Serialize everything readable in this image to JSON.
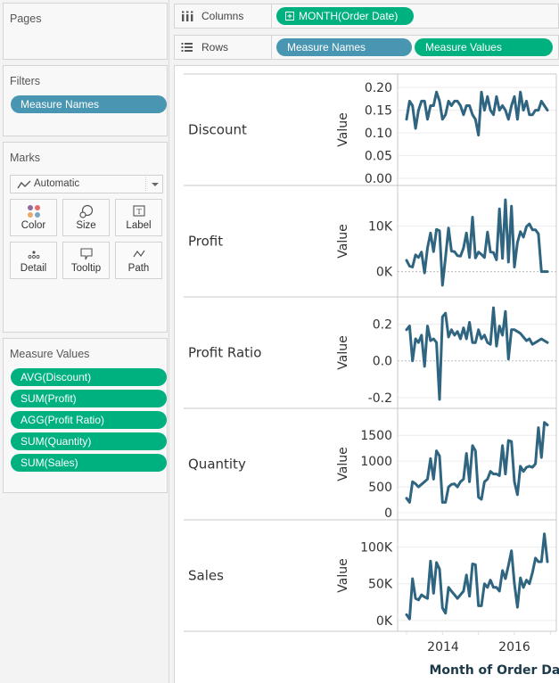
{
  "left_panel": {
    "pages": {
      "title": "Pages"
    },
    "filters": {
      "title": "Filters",
      "pills": [
        {
          "label": "Measure Names",
          "color": "#4996b2"
        }
      ]
    },
    "marks": {
      "title": "Marks",
      "mark_type": "Automatic",
      "buttons": [
        {
          "label": "Color",
          "icon": "color-dots-icon"
        },
        {
          "label": "Size",
          "icon": "size-icon"
        },
        {
          "label": "Label",
          "icon": "label-icon"
        },
        {
          "label": "Detail",
          "icon": "detail-icon"
        },
        {
          "label": "Tooltip",
          "icon": "tooltip-icon"
        },
        {
          "label": "Path",
          "icon": "path-icon"
        }
      ]
    },
    "measure_values": {
      "title": "Measure Values",
      "pills": [
        {
          "label": "AVG(Discount)"
        },
        {
          "label": "SUM(Profit)"
        },
        {
          "label": "AGG(Profit Ratio)"
        },
        {
          "label": "SUM(Quantity)"
        },
        {
          "label": "SUM(Sales)"
        }
      ]
    }
  },
  "shelves": {
    "columns": {
      "label": "Columns",
      "pills": [
        {
          "label": "MONTH(Order Date)",
          "color": "#00b180",
          "has_expand": true
        }
      ]
    },
    "rows": {
      "label": "Rows",
      "pills": [
        {
          "label": "Measure Names",
          "color": "#4996b2"
        },
        {
          "label": "Measure Values",
          "color": "#00b180"
        }
      ]
    }
  },
  "colors": {
    "line": "#2f6580",
    "pill_blue": "#4996b2",
    "pill_green": "#00b180",
    "axis_text": "#333333"
  },
  "chart_data": {
    "type": "line",
    "xlabel": "Month of Order Date",
    "x_start": "2014-01",
    "x_end": "2017-12",
    "x_tick_labels": [
      "2014",
      "2016"
    ],
    "y_axis_title": "Value",
    "panels": [
      {
        "name": "Discount",
        "ylim": [
          0,
          0.21
        ],
        "ticks": [
          "0.20",
          "0.15",
          "0.10",
          "0.05",
          "0.00"
        ],
        "tick_values": [
          0.2,
          0.15,
          0.1,
          0.05,
          0.0
        ],
        "zero_line": false,
        "values": [
          0.13,
          0.17,
          0.16,
          0.11,
          0.15,
          0.17,
          0.17,
          0.13,
          0.16,
          0.16,
          0.19,
          0.17,
          0.13,
          0.14,
          0.17,
          0.16,
          0.17,
          0.17,
          0.16,
          0.14,
          0.16,
          0.16,
          0.14,
          0.13,
          0.095,
          0.19,
          0.15,
          0.18,
          0.15,
          0.14,
          0.18,
          0.15,
          0.16,
          0.15,
          0.13,
          0.16,
          0.18,
          0.13,
          0.19,
          0.15,
          0.17,
          0.14,
          0.14,
          0.15,
          0.15,
          0.17,
          0.16,
          0.15
        ]
      },
      {
        "name": "Profit",
        "ylim": [
          -4000,
          17000
        ],
        "ticks": [
          "10K",
          "0K"
        ],
        "tick_values": [
          10000,
          0
        ],
        "zero_line": true,
        "values": [
          2500,
          1200,
          1000,
          3700,
          3100,
          4300,
          -300,
          5200,
          8500,
          4400,
          9300,
          9000,
          -3000,
          3100,
          9600,
          4500,
          4400,
          3500,
          3400,
          5200,
          8500,
          3100,
          12000,
          3000,
          4300,
          3800,
          3100,
          8700,
          4300,
          4200,
          2600,
          13800,
          2900,
          15800,
          2100,
          14400,
          1000,
          6400,
          8800,
          7600,
          9900,
          10500,
          9200,
          9200,
          8300,
          0,
          0,
          0
        ]
      },
      {
        "name": "Profit Ratio",
        "ylim": [
          -0.22,
          0.3
        ],
        "ticks": [
          "0.2",
          "0.0",
          "-0.2"
        ],
        "tick_values": [
          0.2,
          0.0,
          -0.2
        ],
        "zero_line": true,
        "values": [
          0.17,
          0.19,
          0.0,
          0.12,
          0.1,
          0.14,
          -0.03,
          0.19,
          0.11,
          0.12,
          0.1,
          -0.21,
          0.24,
          0.26,
          0.13,
          0.17,
          0.14,
          0.16,
          0.12,
          0.18,
          0.12,
          0.21,
          0.1,
          0.1,
          0.17,
          0.12,
          0.14,
          0.1,
          0.09,
          0.29,
          0.08,
          0.19,
          0.14,
          0.27,
          0.01,
          0.17,
          0.17,
          0.16,
          0.15,
          0.13,
          0.11,
          0.12,
          0.09,
          0.1,
          0.11,
          0.12,
          0.11,
          0.1
        ]
      },
      {
        "name": "Quantity",
        "ylim": [
          0,
          1850
        ],
        "ticks": [
          "1500",
          "1000",
          "500",
          "0"
        ],
        "tick_values": [
          1500,
          1000,
          500,
          0
        ],
        "zero_line": false,
        "values": [
          280,
          200,
          600,
          560,
          500,
          550,
          600,
          650,
          1050,
          650,
          1200,
          1100,
          200,
          200,
          500,
          550,
          560,
          500,
          600,
          650,
          1150,
          600,
          1300,
          1200,
          300,
          260,
          600,
          650,
          800,
          750,
          750,
          720,
          1300,
          750,
          1400,
          1380,
          600,
          350,
          900,
          800,
          880,
          900,
          880,
          950,
          1650,
          1070,
          1750,
          1700
        ]
      },
      {
        "name": "Sales",
        "ylim": [
          -5000,
          125000
        ],
        "ticks": [
          "100K",
          "50K",
          "0K"
        ],
        "tick_values": [
          100000,
          50000,
          0
        ],
        "zero_line": false,
        "values": [
          8000,
          2000,
          57000,
          30000,
          28000,
          35000,
          32000,
          30000,
          81000,
          37000,
          79000,
          70000,
          17000,
          10000,
          45000,
          40000,
          35000,
          30000,
          35000,
          40000,
          62000,
          33000,
          77000,
          76000,
          20000,
          20000,
          50000,
          45000,
          55000,
          45000,
          45000,
          40000,
          68000,
          57000,
          75000,
          95000,
          50000,
          18000,
          58000,
          45000,
          55000,
          50000,
          65000,
          85000,
          80000,
          80000,
          118000,
          80000
        ]
      }
    ]
  }
}
